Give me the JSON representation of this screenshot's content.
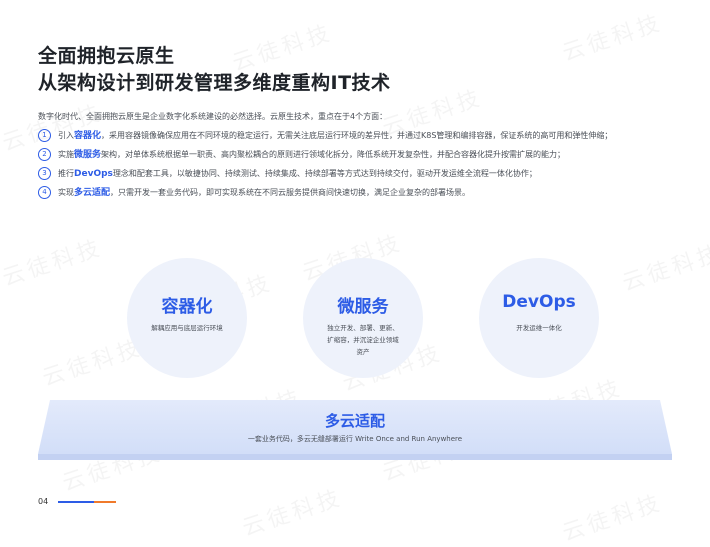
{
  "heading": {
    "line1": "全面拥抱云原生",
    "line2": "从架构设计到研发管理多维度重构IT技术"
  },
  "intro": "数字化时代、全面拥抱云原生是企业数字化系统建设的必然选择。云原生技术，重点在于4个方面：",
  "points": [
    {
      "num": "1",
      "pre": "引入",
      "key": "容器化",
      "post": "，采用容器镜像确保应用在不同环境的稳定运行，无需关注底层运行环境的差异性，并通过K8S管理和编排容器，保证系统的高可用和弹性伸缩；"
    },
    {
      "num": "2",
      "pre": "实施",
      "key": "微服务",
      "post": "架构，对单体系统根据单一职责、高内聚松耦合的原则进行领域化拆分，降低系统开发复杂性，并配合容器化提升按需扩展的能力；"
    },
    {
      "num": "3",
      "pre": "推行",
      "key": "DevOps",
      "post": "理念和配套工具，以敏捷协同、持续测试、持续集成、持续部署等方式达到持续交付，驱动开发运维全流程一体化协作；"
    },
    {
      "num": "4",
      "pre": "实现",
      "key": "多云适配",
      "post": "，只需开发一套业务代码，即可实现系统在不同云服务提供商间快速切换，满足企业复杂的部署场景。"
    }
  ],
  "pillars": [
    {
      "title": "容器化",
      "desc": "解耦应用与底层运行环境"
    },
    {
      "title": "微服务",
      "desc": "独立开发、部署、更新、扩缩容，并沉淀企业领域资产"
    },
    {
      "title": "DevOps",
      "desc": "开发运维一体化"
    }
  ],
  "platform": {
    "title": "多云适配",
    "desc": "一套业务代码，多云无缝部署运行 Write Once and Run Anywhere"
  },
  "watermark": "云徒科技",
  "page_number": "04",
  "colors": {
    "accent": "#2d5ce6",
    "orange": "#f07a2b"
  }
}
